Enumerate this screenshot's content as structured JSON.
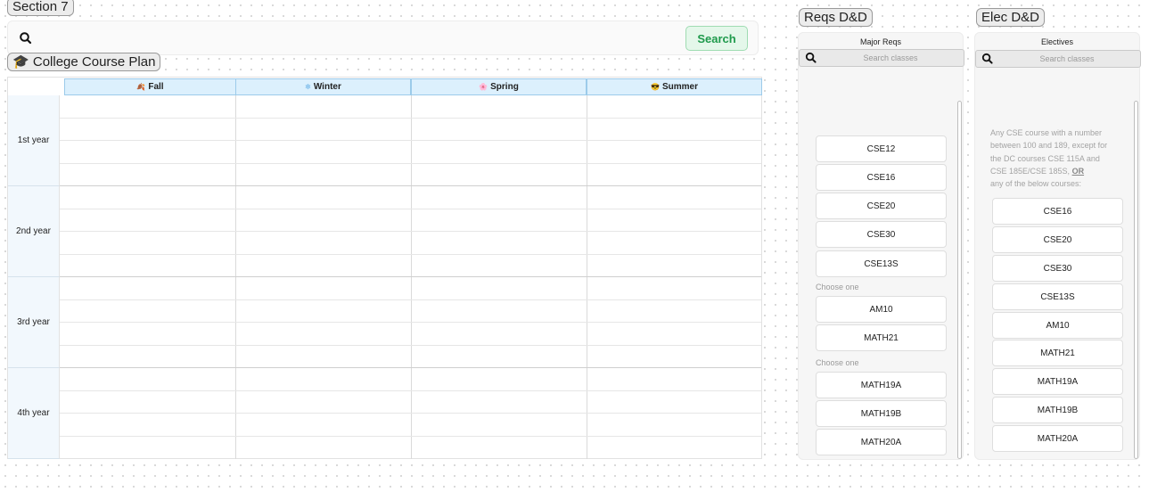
{
  "search_section": {
    "label": "Section 7",
    "search_button": "Search",
    "search_icon": "search-icon"
  },
  "plan": {
    "label": "College Course Plan",
    "label_icon": "graduation-cap-icon",
    "seasons": [
      {
        "emoji": "🍂",
        "label": "Fall"
      },
      {
        "emoji": "❄",
        "label": "Winter"
      },
      {
        "emoji": "🌸",
        "label": "Spring"
      },
      {
        "emoji": "😎",
        "label": "Summer"
      }
    ],
    "years": [
      "1st year",
      "2nd year",
      "3rd year",
      "4th year"
    ],
    "slots_per_year": 4
  },
  "reqs_panel": {
    "frame_label": "Reqs D&D",
    "title": "Major Reqs",
    "search_placeholder": "Search classes",
    "courses": [
      "CSE12",
      "CSE16",
      "CSE20",
      "CSE30",
      "CSE13S"
    ],
    "choose_one_label": "Choose one",
    "choose_group_1": [
      "AM10",
      "MATH21"
    ],
    "choose_group_2": [
      "MATH19A",
      "MATH19B",
      "MATH20A"
    ]
  },
  "elec_panel": {
    "frame_label": "Elec D&D",
    "title": "Electives",
    "search_placeholder": "Search classes",
    "description_lines": [
      "Any CSE course with a number",
      "between 100 and 189, except for",
      "the DC courses CSE 115A and",
      "CSE 185E/CSE 185S,",
      "any of the below courses:"
    ],
    "description_or": "OR",
    "courses": [
      "CSE16",
      "CSE20",
      "CSE30",
      "CSE13S",
      "AM10",
      "MATH21",
      "MATH19A",
      "MATH19B",
      "MATH20A"
    ]
  },
  "colors": {
    "search_button_bg": "#e4f7ea",
    "search_button_text": "#1f9a4c",
    "season_header_bg": "#dcf0fd",
    "year_cell_bg": "#f2f8fd"
  }
}
